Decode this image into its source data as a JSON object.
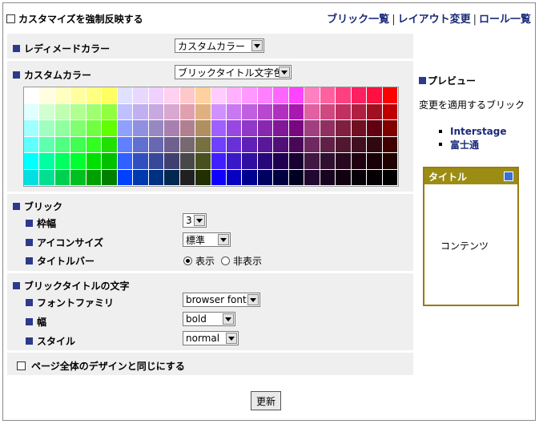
{
  "header": {
    "force_label": "カスタマイズを強制反映する",
    "links": [
      "ブリック一覧",
      "レイアウト変更",
      "ロール一覧"
    ]
  },
  "ready_color": {
    "label": "レディメードカラー",
    "select_value": "カスタムカラー"
  },
  "custom_color": {
    "label": "カスタムカラー",
    "select_value": "ブリックタイトル文字色"
  },
  "palette_colors": [
    [
      "#ffffff",
      "#ffffe0",
      "#ffffc0",
      "#ffffa0",
      "#ffff80",
      "#ffff60",
      "#e0e0ff",
      "#e8d8ff",
      "#f0d0ff",
      "#ffd0f0",
      "#ffc8c8",
      "#ffd0a0",
      "#ffccff",
      "#ffb0ff",
      "#ff98ff",
      "#ff80ff",
      "#ff66ff",
      "#ff44ff",
      "#ff80c0",
      "#ff60a0",
      "#ff4080",
      "#ff2060",
      "#ff1040",
      "#ff0000"
    ],
    [
      "#e0ffff",
      "#d0ffd0",
      "#c0ffb0",
      "#b0ff90",
      "#a0ff70",
      "#90ff40",
      "#c0c0ff",
      "#c0b0f0",
      "#c8a8e0",
      "#d8a8d0",
      "#e0a0b0",
      "#e0b080",
      "#d090ff",
      "#c878f0",
      "#c060e0",
      "#b848d0",
      "#b030c0",
      "#a818b0",
      "#e060a0",
      "#d04880",
      "#c03060",
      "#b02040",
      "#a01020",
      "#c00000"
    ],
    [
      "#a0ffff",
      "#a0ffc0",
      "#90ffa0",
      "#80ff70",
      "#70ff40",
      "#60ff00",
      "#90a0ff",
      "#9090e0",
      "#9888c0",
      "#a880b0",
      "#b08090",
      "#b09060",
      "#a060ff",
      "#9848e0",
      "#9038c8",
      "#8828b0",
      "#801898",
      "#780880",
      "#a04080",
      "#903060",
      "#802040",
      "#701020",
      "#600010",
      "#800000"
    ],
    [
      "#60ffff",
      "#60ffb0",
      "#50ff80",
      "#40ff50",
      "#30ff20",
      "#20e000",
      "#6080ff",
      "#6070d0",
      "#6868b0",
      "#706090",
      "#786870",
      "#787040",
      "#7040ff",
      "#6830d8",
      "#6020b8",
      "#581898",
      "#501078",
      "#480858",
      "#702860",
      "#602048",
      "#501830",
      "#401020",
      "#300810",
      "#400000"
    ],
    [
      "#00ffff",
      "#00ffa0",
      "#00ff60",
      "#00ff30",
      "#00e000",
      "#00c000",
      "#3060ff",
      "#3050c0",
      "#384898",
      "#404070",
      "#484848",
      "#485020",
      "#4020ff",
      "#3818c8",
      "#3010a0",
      "#280878",
      "#200050",
      "#180030",
      "#401840",
      "#301030",
      "#280820",
      "#200010",
      "#180008",
      "#200000"
    ],
    [
      "#00e0e0",
      "#00e090",
      "#00d050",
      "#00c020",
      "#00a000",
      "#008000",
      "#0040ff",
      "#0038b0",
      "#003080",
      "#002850",
      "#202020",
      "#203000",
      "#1000ff",
      "#0800c0",
      "#000090",
      "#000060",
      "#000040",
      "#000020",
      "#200830",
      "#180420",
      "#100010",
      "#080008",
      "#040004",
      "#000000"
    ]
  ],
  "brick": {
    "label": "ブリック",
    "frame_width_label": "枠幅",
    "frame_width_value": "3",
    "icon_size_label": "アイコンサイズ",
    "icon_size_value": "標準",
    "title_bar_label": "タイトルバー",
    "show_label": "表示",
    "hide_label": "非表示"
  },
  "brick_title_text": {
    "label": "ブリックタイトルの文字",
    "font_family_label": "フォントファミリ",
    "font_family_value": "browser font",
    "width_label": "幅",
    "width_value": "bold",
    "style_label": "スタイル",
    "style_value": "normal"
  },
  "same_design_label": "ページ全体のデザインと同じにする",
  "update_label": "更新",
  "preview": {
    "heading": "プレビュー",
    "description": "変更を適用するブリック",
    "items": [
      "Interstage",
      "富士通"
    ],
    "brick_title": "タイトル",
    "brick_content": "コンテンツ"
  },
  "colors": {
    "accent": "#2b3a8c",
    "brick_bar": "#9b8d14",
    "brick_border": "#9b7a14",
    "link": "#1a2a78"
  }
}
